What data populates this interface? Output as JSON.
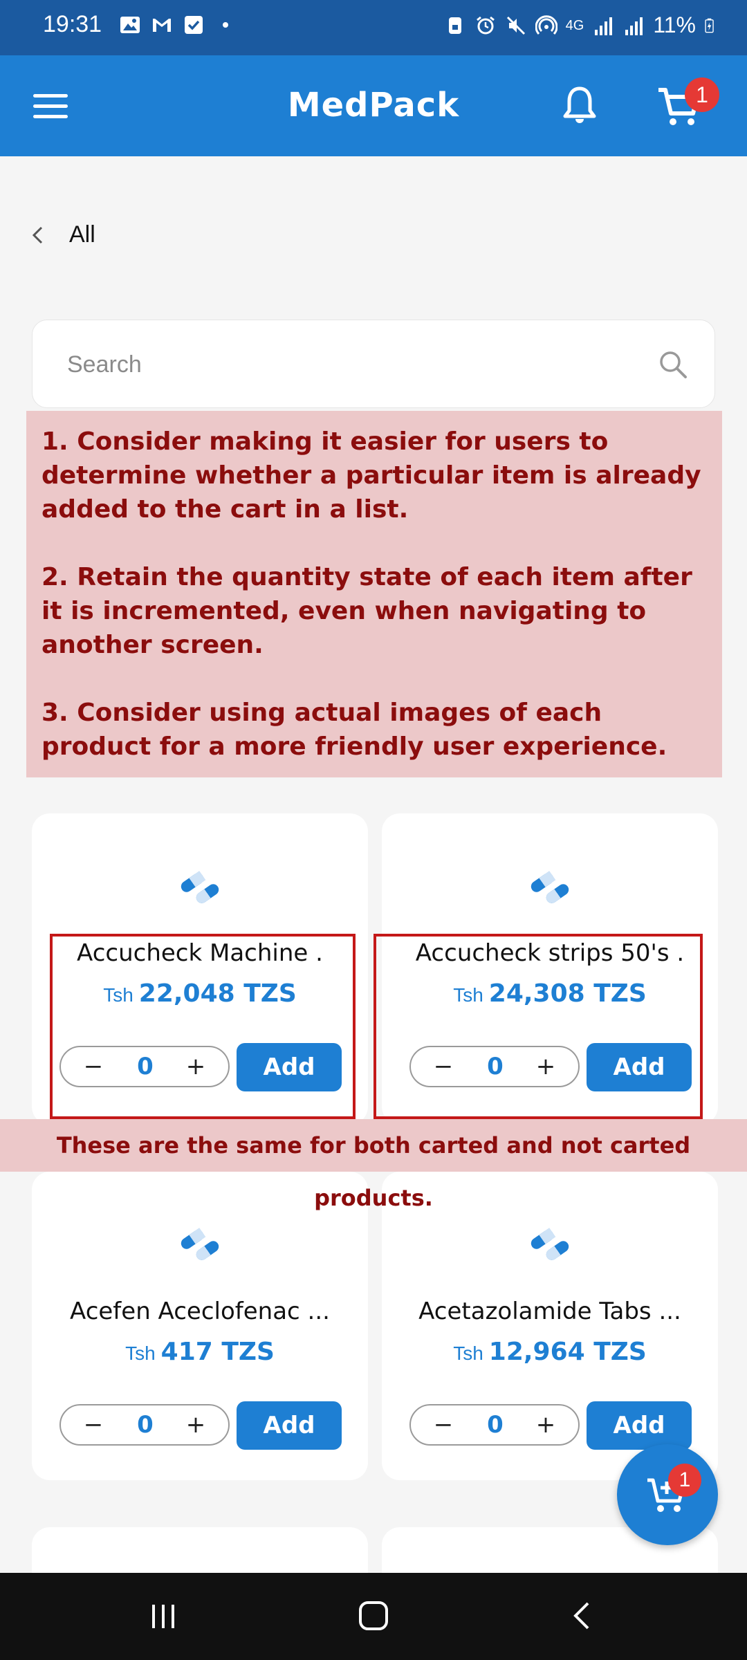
{
  "status_bar": {
    "time": "19:31",
    "battery": "11%",
    "network": "4G"
  },
  "app_bar": {
    "title": "MedPack",
    "cart_count": "1"
  },
  "breadcrumb": {
    "label": "All"
  },
  "search": {
    "placeholder": "Search"
  },
  "notes": [
    "1. Consider making it easier for users to determine whether a particular item is already added to the cart in a list.",
    "2. Retain the quantity state of each item after it is incremented, even when navigating to another screen.",
    "3. Consider using actual images of each product for a more friendly user experience."
  ],
  "bottom_note": "These are the same for both carted and not carted products.",
  "products": [
    {
      "name": "Accucheck Machine .",
      "currency": "Tsh",
      "price": "22,048 TZS",
      "qty": "0",
      "add_label": "Add",
      "minus": "−",
      "plus": "+"
    },
    {
      "name": "Accucheck strips 50's .",
      "currency": "Tsh",
      "price": "24,308 TZS",
      "qty": "0",
      "add_label": "Add",
      "minus": "−",
      "plus": "+"
    },
    {
      "name": "Acefen Aceclofenac ...",
      "currency": "Tsh",
      "price": "417 TZS",
      "qty": "0",
      "add_label": "Add",
      "minus": "−",
      "plus": "+"
    },
    {
      "name": "Acetazolamide Tabs ...",
      "currency": "Tsh",
      "price": "12,964 TZS",
      "qty": "0",
      "add_label": "Add",
      "minus": "−",
      "plus": "+"
    }
  ],
  "fab": {
    "cart_count": "1"
  },
  "colors": {
    "primary": "#1e7fd3",
    "status_bar": "#1b5aa0",
    "annotation_bg": "#ecc8c9",
    "annotation_text": "#8b0d0d",
    "highlight_border": "#c41818",
    "badge": "#e53935"
  }
}
